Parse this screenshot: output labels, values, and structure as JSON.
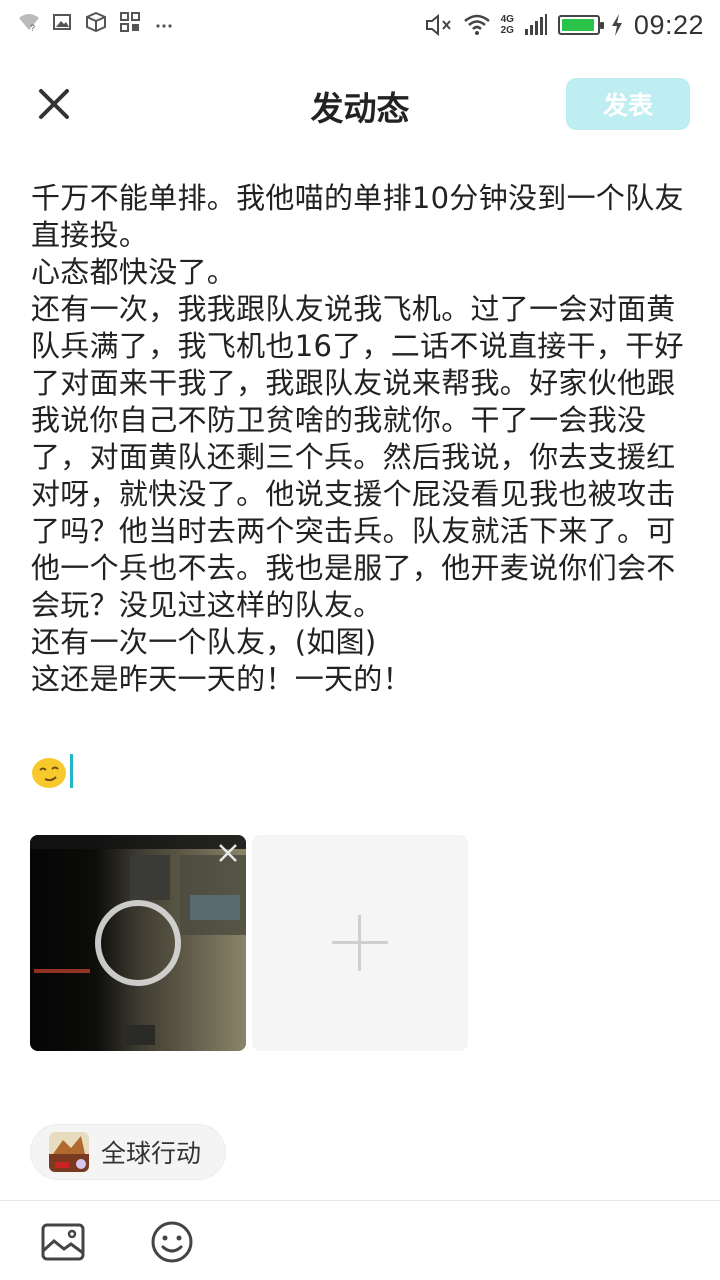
{
  "status_bar": {
    "time": "09:22",
    "network_top": "4G",
    "network_bottom": "2G",
    "battery_level": 0.95,
    "left_icons": [
      "wifi-question-icon",
      "image-icon",
      "box-icon",
      "grid-icon",
      "more-dots-icon"
    ],
    "right_icons": [
      "mute-icon",
      "wifi-icon",
      "signal-icon",
      "battery-icon",
      "charging-icon"
    ]
  },
  "header": {
    "title": "发动态",
    "publish_label": "发表",
    "close_icon": "close-icon"
  },
  "post": {
    "text": "千万不能单排。我他喵的单排10分钟没到一个队友直接投。\n心态都快没了。\n还有一次，我我跟队友说我飞机。过了一会对面黄队兵满了，我飞机也16了，二话不说直接干，干好了对面来干我了，我跟队友说来帮我。好家伙他跟我说你自己不防卫贫啥的我就你。干了一会我没了，对面黄队还剩三个兵。然后我说，你去支援红对呀，就快没了。他说支援个屁没看见我也被攻击了吗？他当时去两个突击兵。队友就活下来了。可他一个兵也不去。我也是服了，他开麦说你们会不会玩？没见过这样的队友。\n还有一次一个队友，(如图)\n这还是昨天一天的！一天的！",
    "emoji": "smirk-emoji-icon"
  },
  "images": {
    "attached_count": 1,
    "add_icon": "plus-icon",
    "remove_icon": "close-icon"
  },
  "topic": {
    "label": "全球行动",
    "icon": "game-icon"
  },
  "toolbar": {
    "items": [
      "image-picker-icon",
      "emoji-picker-icon"
    ]
  },
  "colors": {
    "accent": "#20b8c8",
    "publish_disabled_bg": "#bfeef2",
    "battery": "#2bc24a"
  }
}
